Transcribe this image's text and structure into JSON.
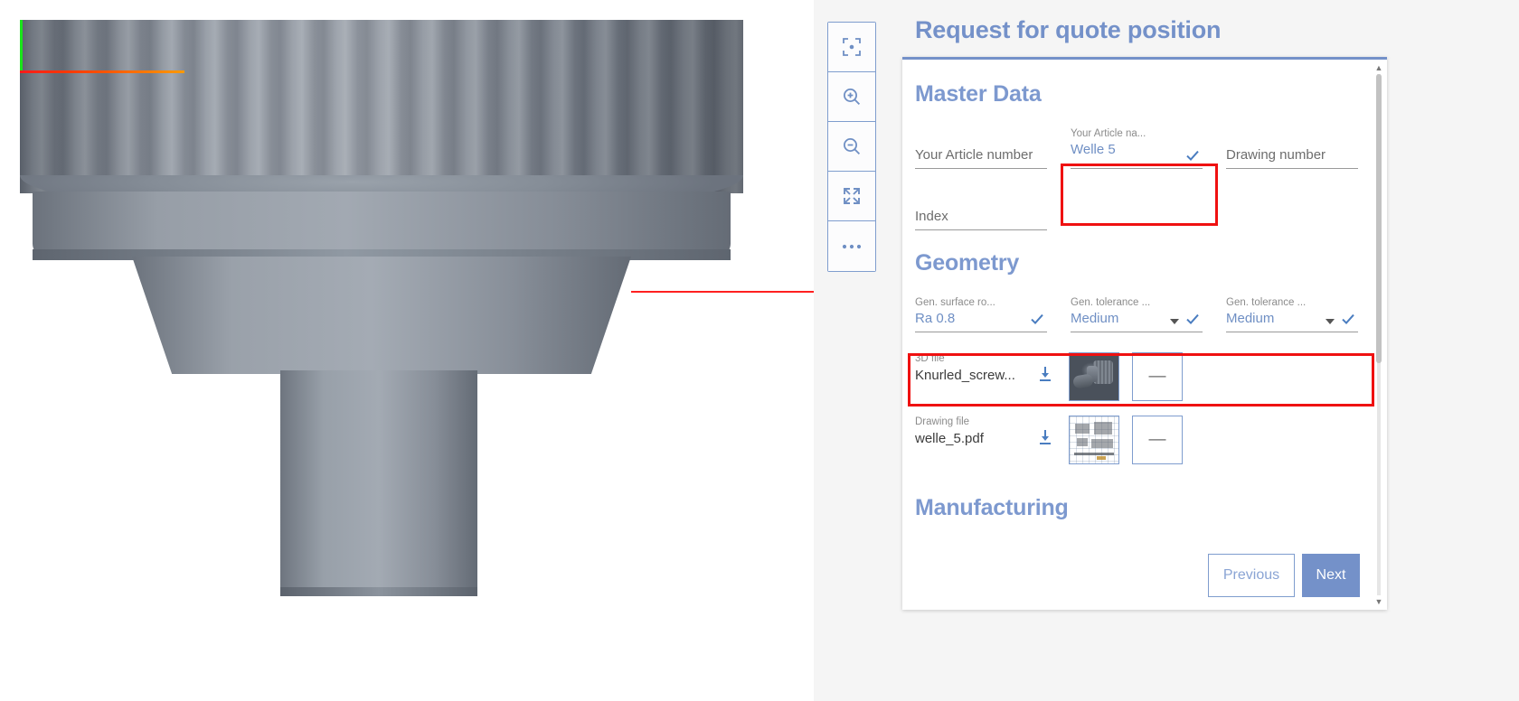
{
  "page": {
    "title": "Request for quote position"
  },
  "viewport": {
    "name": "3d-model-viewport",
    "axes": {
      "y_color": "#19e619",
      "x_color": "#ff6a00"
    },
    "annotation_color": "#ff2020"
  },
  "toolbar": {
    "buttons": [
      {
        "name": "fit-to-view-icon",
        "label": "Fit to view"
      },
      {
        "name": "zoom-in-icon",
        "label": "Zoom in"
      },
      {
        "name": "zoom-out-icon",
        "label": "Zoom out"
      },
      {
        "name": "fullscreen-icon",
        "label": "Fullscreen"
      },
      {
        "name": "more-options-icon",
        "label": "More options"
      }
    ]
  },
  "form": {
    "sections": {
      "master_data": "Master Data",
      "geometry": "Geometry",
      "manufacturing": "Manufacturing"
    },
    "master_data_fields": [
      {
        "label": "",
        "placeholder": "Your Article number",
        "value": "",
        "has_check": false,
        "has_caret": false,
        "highlighted": false
      },
      {
        "label": "Your Article na...",
        "placeholder": "",
        "value": "Welle 5",
        "has_check": true,
        "has_caret": false,
        "highlighted": true
      },
      {
        "label": "",
        "placeholder": "Drawing number",
        "value": "",
        "has_check": false,
        "has_caret": false,
        "highlighted": false
      },
      {
        "label": "",
        "placeholder": "Index",
        "value": "",
        "has_check": false,
        "has_caret": false,
        "highlighted": false
      }
    ],
    "geometry_fields": [
      {
        "label": "Gen. surface ro...",
        "value": "Ra 0.8",
        "has_check": true,
        "has_caret": false
      },
      {
        "label": "Gen. tolerance ...",
        "value": "Medium",
        "has_check": true,
        "has_caret": true
      },
      {
        "label": "Gen. tolerance ...",
        "value": "Medium",
        "has_check": true,
        "has_caret": true
      }
    ],
    "files": [
      {
        "label": "3D file",
        "name": "Knurled_screw...",
        "thumb": "3d-model-thumbnail",
        "remove_label": "—"
      },
      {
        "label": "Drawing file",
        "name": "welle_5.pdf",
        "thumb": "drawing-thumbnail",
        "remove_label": "—"
      }
    ],
    "footer": {
      "previous": "Previous",
      "next": "Next"
    }
  },
  "colors": {
    "accent": "#7491c9",
    "value_text": "#6f8fc4",
    "highlight": "#ef1111",
    "label_text": "#8b8b8b"
  }
}
